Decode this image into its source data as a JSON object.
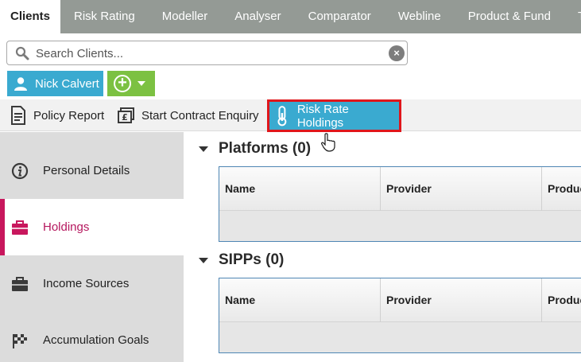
{
  "top_tabs": [
    "Clients",
    "Risk Rating",
    "Modeller",
    "Analyser",
    "Comparator",
    "Webline",
    "Product & Fund",
    "Tools &"
  ],
  "search": {
    "placeholder": "Search Clients..."
  },
  "client": {
    "name": "Nick Calvert"
  },
  "toolbar": {
    "policy_report": "Policy Report",
    "start_contract_enquiry": "Start Contract Enquiry",
    "risk_rate_holdings": "Risk Rate Holdings"
  },
  "sidebar": {
    "items": [
      {
        "label": "Personal Details",
        "icon": "info-icon"
      },
      {
        "label": "Holdings",
        "icon": "briefcase-icon",
        "active": true
      },
      {
        "label": "Income Sources",
        "icon": "briefcase-icon"
      },
      {
        "label": "Accumulation Goals",
        "icon": "checkered-flag-icon"
      }
    ]
  },
  "sections": [
    {
      "title": "Platforms (0)",
      "columns": [
        "Name",
        "Provider",
        "Produc"
      ]
    },
    {
      "title": "SIPPs (0)",
      "columns": [
        "Name",
        "Provider",
        "Produc"
      ]
    }
  ],
  "colors": {
    "tab_bar": "#949a95",
    "accent_blue": "#3aaad0",
    "accent_green": "#7cc142",
    "highlight_red": "#e0161b",
    "active_magenta": "#c8175d"
  }
}
